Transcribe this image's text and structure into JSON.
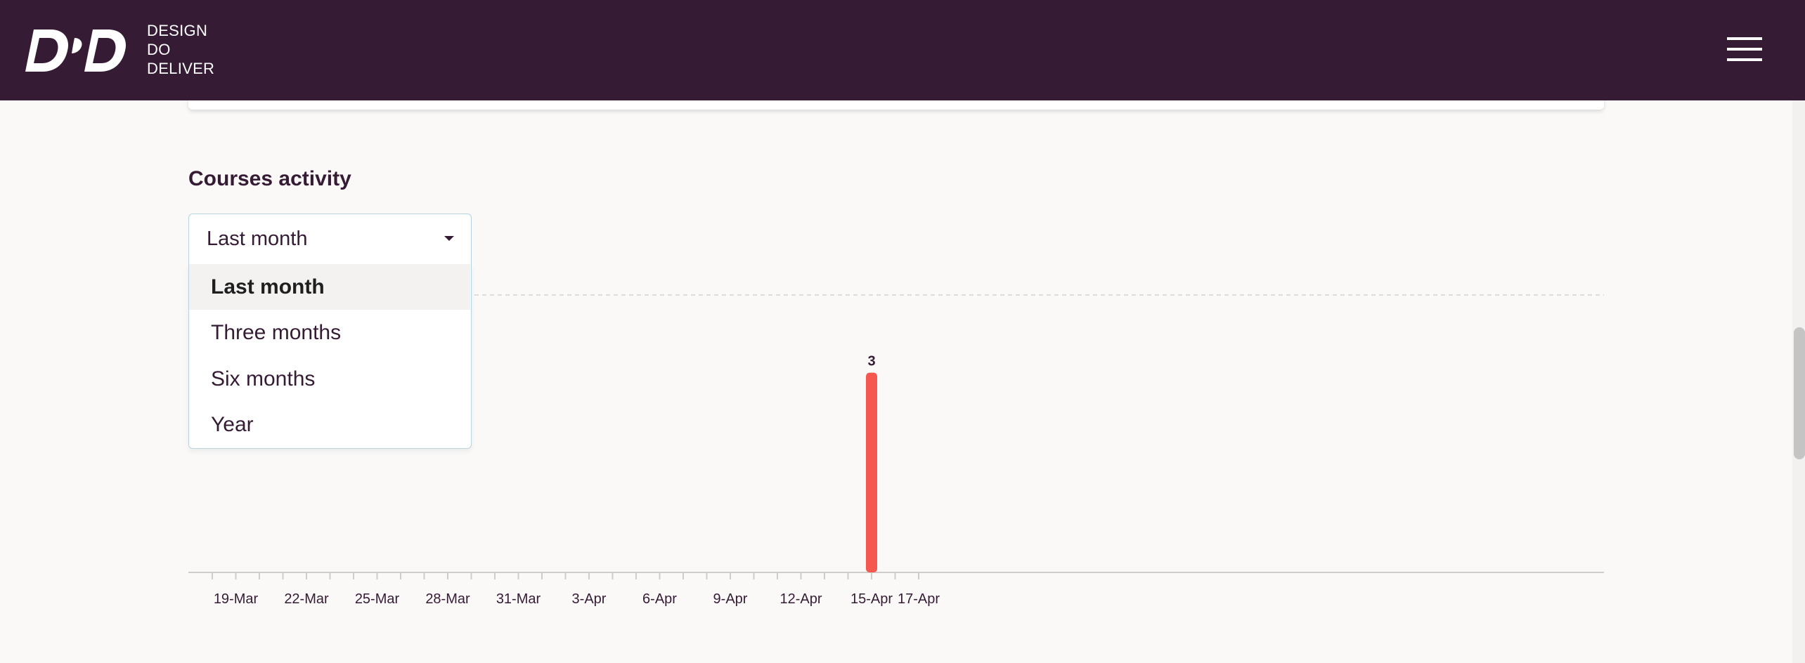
{
  "header": {
    "brand_lines": [
      "DESIGN",
      "DO",
      "DELIVER"
    ],
    "logo_icon": "ddd-logo",
    "menu_icon": "hamburger-menu-icon"
  },
  "courses_activity": {
    "title": "Courses activity",
    "filter": {
      "selected": "Last month",
      "options": [
        "Last month",
        "Three months",
        "Six months",
        "Year"
      ]
    }
  },
  "colors": {
    "header_bg": "#351c34",
    "bar": "#f4584f",
    "page_bg": "#faf9f8"
  },
  "chart_data": {
    "type": "bar",
    "x": [
      "18-Mar",
      "19-Mar",
      "20-Mar",
      "21-Mar",
      "22-Mar",
      "23-Mar",
      "24-Mar",
      "25-Mar",
      "26-Mar",
      "27-Mar",
      "28-Mar",
      "29-Mar",
      "30-Mar",
      "31-Mar",
      "1-Apr",
      "2-Apr",
      "3-Apr",
      "4-Apr",
      "5-Apr",
      "6-Apr",
      "7-Apr",
      "8-Apr",
      "9-Apr",
      "10-Apr",
      "11-Apr",
      "12-Apr",
      "13-Apr",
      "14-Apr",
      "15-Apr",
      "16-Apr",
      "17-Apr"
    ],
    "values": [
      0,
      0,
      0,
      0,
      0,
      0,
      0,
      0,
      0,
      0,
      0,
      0,
      0,
      0,
      0,
      0,
      0,
      0,
      0,
      0,
      0,
      0,
      0,
      0,
      0,
      0,
      0,
      0,
      3,
      0,
      0
    ],
    "tick_labels": [
      "19-Mar",
      "22-Mar",
      "25-Mar",
      "28-Mar",
      "31-Mar",
      "3-Apr",
      "6-Apr",
      "9-Apr",
      "12-Apr",
      "15-Apr",
      "17-Apr"
    ],
    "data_labels": [
      {
        "x": "15-Apr",
        "label": "3"
      }
    ],
    "ylim": [
      0,
      4
    ],
    "grid": "dashed line at top",
    "legend": "none"
  }
}
